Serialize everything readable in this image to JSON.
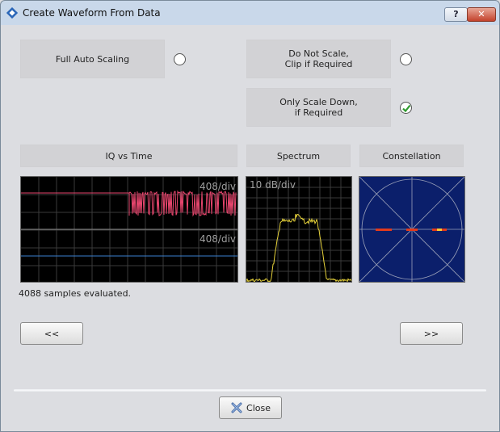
{
  "window": {
    "title": "Create Waveform From Data",
    "help_label": "?",
    "close_label": "✕"
  },
  "scaling": {
    "full_auto": {
      "label": "Full Auto Scaling",
      "checked": false
    },
    "do_not_scale": {
      "line1": "Do Not Scale,",
      "line2": "Clip if Required",
      "checked": false
    },
    "only_scale_down": {
      "line1": "Only Scale Down,",
      "line2": "if Required",
      "checked": true
    }
  },
  "views": {
    "iq": {
      "label": "IQ vs Time",
      "scale_top": "408/div",
      "scale_bottom": "408/div"
    },
    "spectrum": {
      "label": "Spectrum",
      "scale": "10 dB/div"
    },
    "constellation": {
      "label": "Constellation"
    }
  },
  "status": "4088 samples evaluated.",
  "nav": {
    "prev_label": "<<",
    "next_label": ">>"
  },
  "footer": {
    "close_label": "Close"
  },
  "colors": {
    "i_trace": "#e8466e",
    "q_trace": "#3a7fd0",
    "spectrum_trace": "#e6d23a",
    "constellation_bg": "#0b1f6b"
  }
}
